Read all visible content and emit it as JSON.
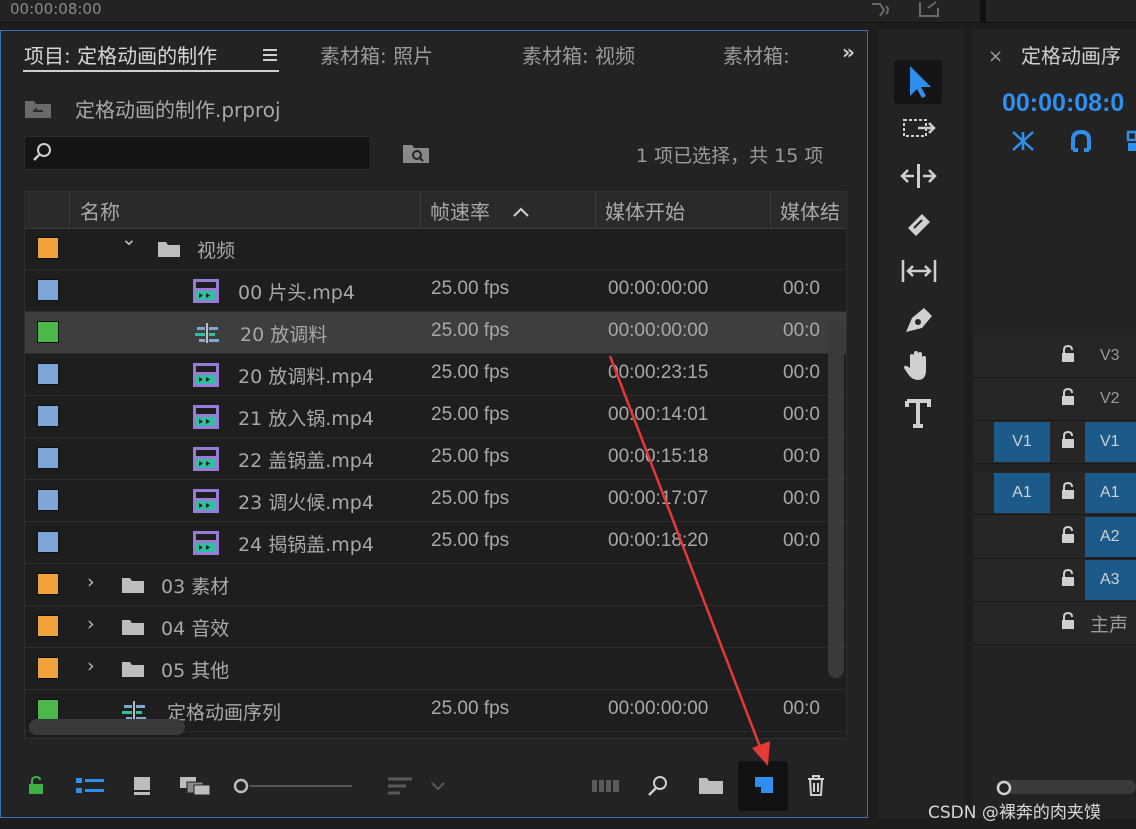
{
  "topbar": {
    "timecode": "00:00:08:00"
  },
  "project_panel": {
    "tabs": [
      {
        "label": "项目: 定格动画的制作"
      },
      {
        "label": "素材箱: 照片"
      },
      {
        "label": "素材箱: 视频"
      },
      {
        "label": "素材箱:"
      }
    ],
    "project_file": "定格动画的制作.prproj",
    "search_placeholder": "",
    "item_count": "1 项已选择，共 15 项",
    "columns": [
      "名称",
      "帧速率",
      "媒体开始",
      "媒体结"
    ],
    "rows": [
      {
        "name": "视频",
        "type": "folder",
        "expanded": true,
        "color": "#f0a33a",
        "fps": "",
        "start": "",
        "end": ""
      },
      {
        "name": "00 片头.mp4",
        "type": "clip",
        "color": "#7ea7d8",
        "fps": "25.00 fps",
        "start": "00:00:00:00",
        "end": "00:0"
      },
      {
        "name": "20 放调料",
        "type": "sequence",
        "color": "#4cb84c",
        "selected": true,
        "fps": "25.00 fps",
        "start": "00:00:00:00",
        "end": "00:0"
      },
      {
        "name": "20 放调料.mp4",
        "type": "clip",
        "color": "#7ea7d8",
        "fps": "25.00 fps",
        "start": "00:00:23:15",
        "end": "00:0"
      },
      {
        "name": "21 放入锅.mp4",
        "type": "clip",
        "color": "#7ea7d8",
        "fps": "25.00 fps",
        "start": "00:00:14:01",
        "end": "00:0"
      },
      {
        "name": "22 盖锅盖.mp4",
        "type": "clip",
        "color": "#7ea7d8",
        "fps": "25.00 fps",
        "start": "00:00:15:18",
        "end": "00:0"
      },
      {
        "name": "23 调火候.mp4",
        "type": "clip",
        "color": "#7ea7d8",
        "fps": "25.00 fps",
        "start": "00:00:17:07",
        "end": "00:0"
      },
      {
        "name": "24 揭锅盖.mp4",
        "type": "clip",
        "color": "#7ea7d8",
        "fps": "25.00 fps",
        "start": "00:00:18:20",
        "end": "00:0"
      },
      {
        "name": "03 素材",
        "type": "folder",
        "expanded": false,
        "color": "#f0a33a",
        "fps": "",
        "start": "",
        "end": ""
      },
      {
        "name": "04 音效",
        "type": "folder",
        "expanded": false,
        "color": "#f0a33a",
        "fps": "",
        "start": "",
        "end": ""
      },
      {
        "name": "05 其他",
        "type": "folder",
        "expanded": false,
        "color": "#f0a33a",
        "fps": "",
        "start": "",
        "end": ""
      },
      {
        "name": "定格动画序列",
        "type": "sequence",
        "color": "#4cb84c",
        "fps": "25.00 fps",
        "start": "00:00:00:00",
        "end": "00:0"
      }
    ]
  },
  "sequence_panel": {
    "title": "定格动画序",
    "timecode": "00:00:08:0",
    "tracks": [
      {
        "name": "V3",
        "source": "",
        "target": false
      },
      {
        "name": "V2",
        "source": "",
        "target": false
      },
      {
        "name": "V1",
        "source": "V1",
        "target": true
      },
      {
        "name": "A1",
        "source": "A1",
        "target": true
      },
      {
        "name": "A2",
        "source": "",
        "target": true
      },
      {
        "name": "A3",
        "source": "",
        "target": true
      },
      {
        "name": "主声",
        "source": "",
        "target": false
      }
    ]
  },
  "colors": {
    "accent": "#2e8ff0",
    "highlight_arrow": "#e53935",
    "folder_label": "#f0a33a",
    "clip_label": "#7ea7d8",
    "seq_label": "#4cb84c"
  },
  "watermark": "CSDN @裸奔的肉夹馍"
}
